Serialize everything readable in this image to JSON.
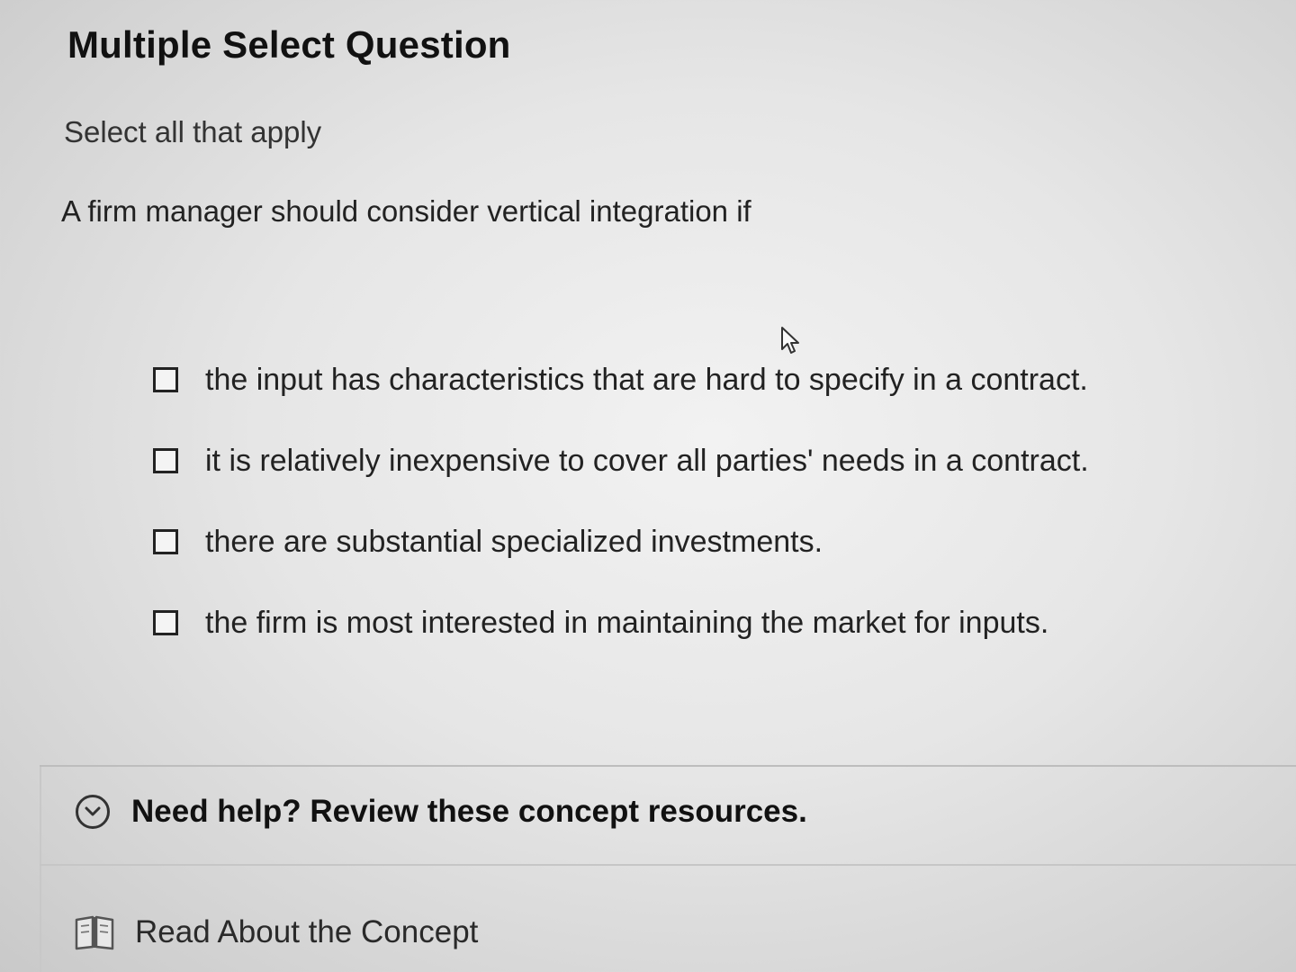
{
  "question": {
    "title": "Multiple Select Question",
    "instruction": "Select all that apply",
    "prompt": "A firm manager should consider vertical integration if",
    "options": [
      {
        "label": "the input has characteristics that are hard to specify in a contract.",
        "checked": false
      },
      {
        "label": "it is relatively inexpensive to cover all parties' needs in a contract.",
        "checked": false
      },
      {
        "label": "there are substantial specialized investments.",
        "checked": false
      },
      {
        "label": "the firm is most interested in maintaining the market for inputs.",
        "checked": false
      }
    ]
  },
  "help": {
    "toggle_label": "Need help? Review these concept resources.",
    "resource_label": "Read About the Concept"
  },
  "icons": {
    "toggle": "chevron-down-circle-icon",
    "resource": "book-icon",
    "cursor": "mouse-pointer-icon"
  }
}
